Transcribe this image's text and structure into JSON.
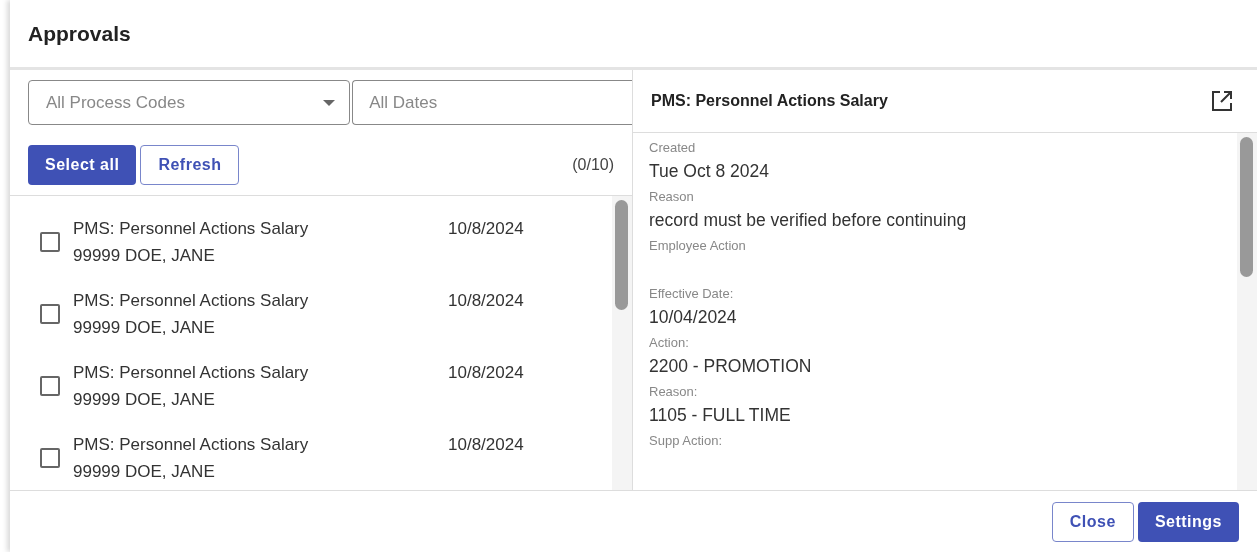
{
  "window": {
    "title": "Approvals"
  },
  "filters": {
    "process_code": {
      "placeholder": "All Process Codes"
    },
    "dates": {
      "placeholder": "All Dates"
    }
  },
  "actions": {
    "select_all": "Select all",
    "refresh": "Refresh",
    "count": "(0/10)"
  },
  "items": [
    {
      "title": "PMS: Personnel Actions Salary",
      "subtitle": "99999 DOE, JANE",
      "date": "10/8/2024",
      "checked": false
    },
    {
      "title": "PMS: Personnel Actions Salary",
      "subtitle": "99999 DOE, JANE",
      "date": "10/8/2024",
      "checked": false
    },
    {
      "title": "PMS: Personnel Actions Salary",
      "subtitle": "99999 DOE, JANE",
      "date": "10/8/2024",
      "checked": false
    },
    {
      "title": "PMS: Personnel Actions Salary",
      "subtitle": "99999 DOE, JANE",
      "date": "10/8/2024",
      "checked": false
    }
  ],
  "detail": {
    "title": "PMS: Personnel Actions Salary",
    "fields": [
      {
        "label": "Created",
        "value": "Tue Oct 8 2024"
      },
      {
        "label": "Reason",
        "value": "record must be verified before continuing"
      },
      {
        "label": "Employee Action"
      },
      {
        "label": "Effective Date:",
        "value": "10/04/2024"
      },
      {
        "label": "Action:",
        "value": "2200 - PROMOTION"
      },
      {
        "label": "Reason:",
        "value": "1105 - FULL TIME"
      },
      {
        "label": "Supp Action:"
      }
    ]
  },
  "footer": {
    "buttons": [
      {
        "label": "Close",
        "kind": "outline"
      },
      {
        "label": "Settings",
        "kind": "primary"
      }
    ]
  }
}
